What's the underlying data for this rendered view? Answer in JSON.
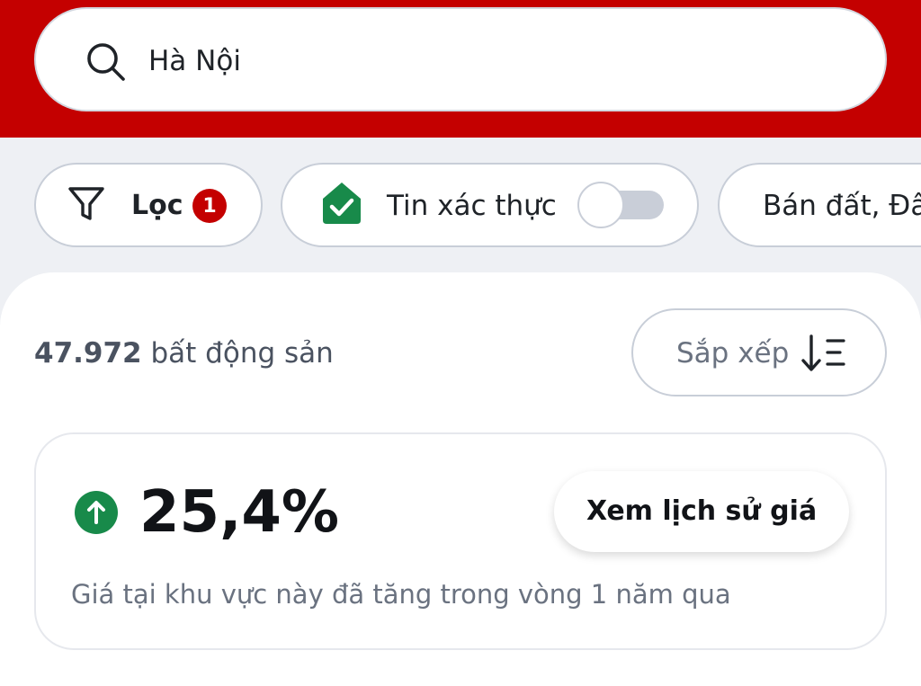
{
  "search": {
    "value": "Hà Nội"
  },
  "filters": {
    "filter_label": "Lọc",
    "filter_badge": "1",
    "verified_label": "Tin xác thực",
    "verified_enabled": false,
    "property_type_label": "Bán đất, Đâ"
  },
  "results": {
    "count": "47.972",
    "count_suffix": "bất động sản",
    "sort_label": "Sắp xếp"
  },
  "price_trend": {
    "direction": "up",
    "value": "25,4%",
    "history_button": "Xem lịch sử giá",
    "description": "Giá tại khu vực này đã tăng trong vòng 1 năm qua"
  },
  "colors": {
    "brand_red": "#c40000",
    "verified_green": "#188a4a",
    "trend_green": "#188a4a"
  },
  "icons": {
    "search": "search-icon",
    "filter": "funnel-icon",
    "verified": "verified-house-check-icon",
    "sort": "sort-descending-icon",
    "trend": "arrow-up-circle-icon"
  }
}
